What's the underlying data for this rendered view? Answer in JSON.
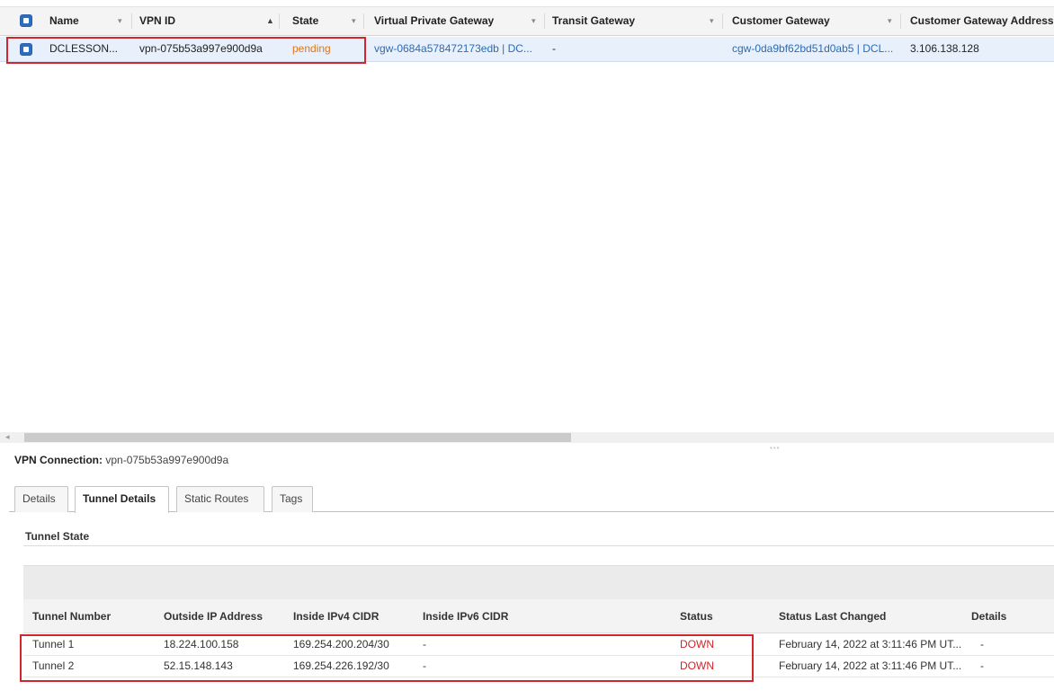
{
  "grid": {
    "columns": [
      {
        "label": "Name"
      },
      {
        "label": "VPN ID"
      },
      {
        "label": "State"
      },
      {
        "label": "Virtual Private Gateway"
      },
      {
        "label": "Transit Gateway"
      },
      {
        "label": "Customer Gateway"
      },
      {
        "label": "Customer Gateway Address"
      }
    ],
    "row": {
      "name": "DCLESSON...",
      "vpn_id": "vpn-075b53a997e900d9a",
      "state": "pending",
      "vgw": "vgw-0684a578472173edb | DC...",
      "tgw": "-",
      "cgw": "cgw-0da9bf62bd51d0ab5 | DCL...",
      "cgw_address": "3.106.138.128"
    }
  },
  "details": {
    "connection_label": "VPN Connection:",
    "connection_id": "vpn-075b53a997e900d9a",
    "tabs": [
      "Details",
      "Tunnel Details",
      "Static Routes",
      "Tags"
    ],
    "active_tab": "Tunnel Details",
    "section_title": "Tunnel State",
    "headers": [
      "Tunnel Number",
      "Outside IP Address",
      "Inside IPv4 CIDR",
      "Inside IPv6 CIDR",
      "Status",
      "Status Last Changed",
      "Details"
    ],
    "tunnels": [
      {
        "number": "Tunnel 1",
        "outside_ip": "18.224.100.158",
        "inside_ipv4": "169.254.200.204/30",
        "inside_ipv6": "-",
        "status": "DOWN",
        "changed": "February 14, 2022 at 3:11:46 PM UT...",
        "details": "-"
      },
      {
        "number": "Tunnel 2",
        "outside_ip": "52.15.148.143",
        "inside_ipv4": "169.254.226.192/30",
        "inside_ipv6": "-",
        "status": "DOWN",
        "changed": "February 14, 2022 at 3:11:46 PM UT...",
        "details": "-"
      }
    ]
  },
  "colors": {
    "highlight": "#d0262c",
    "link": "#2c6bb5",
    "pending": "#e0761b",
    "down": "#d0262c",
    "selected_row": "#e8f0fb"
  },
  "icons": {
    "sort_desc": "▾",
    "sort_asc": "▲",
    "scroll_left": "◂"
  }
}
